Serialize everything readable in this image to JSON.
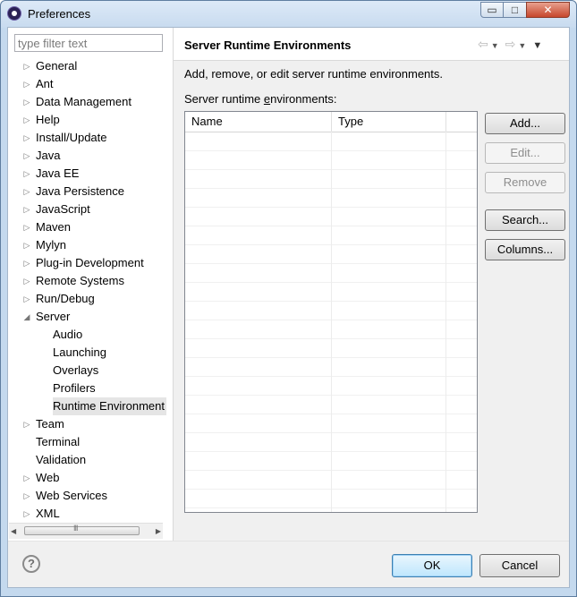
{
  "window": {
    "title": "Preferences",
    "controls": {
      "minimize": "▭",
      "maximize": "□",
      "close": "✕"
    }
  },
  "filter": {
    "placeholder": "type filter text",
    "value": ""
  },
  "tree": {
    "items": [
      {
        "label": "General",
        "level": 0,
        "expander": "collapsed"
      },
      {
        "label": "Ant",
        "level": 0,
        "expander": "collapsed"
      },
      {
        "label": "Data Management",
        "level": 0,
        "expander": "collapsed"
      },
      {
        "label": "Help",
        "level": 0,
        "expander": "collapsed"
      },
      {
        "label": "Install/Update",
        "level": 0,
        "expander": "collapsed"
      },
      {
        "label": "Java",
        "level": 0,
        "expander": "collapsed"
      },
      {
        "label": "Java EE",
        "level": 0,
        "expander": "collapsed"
      },
      {
        "label": "Java Persistence",
        "level": 0,
        "expander": "collapsed"
      },
      {
        "label": "JavaScript",
        "level": 0,
        "expander": "collapsed"
      },
      {
        "label": "Maven",
        "level": 0,
        "expander": "collapsed"
      },
      {
        "label": "Mylyn",
        "level": 0,
        "expander": "collapsed"
      },
      {
        "label": "Plug-in Development",
        "level": 0,
        "expander": "collapsed"
      },
      {
        "label": "Remote Systems",
        "level": 0,
        "expander": "collapsed"
      },
      {
        "label": "Run/Debug",
        "level": 0,
        "expander": "collapsed"
      },
      {
        "label": "Server",
        "level": 0,
        "expander": "expanded"
      },
      {
        "label": "Audio",
        "level": 1,
        "expander": "none"
      },
      {
        "label": "Launching",
        "level": 1,
        "expander": "none"
      },
      {
        "label": "Overlays",
        "level": 1,
        "expander": "none"
      },
      {
        "label": "Profilers",
        "level": 1,
        "expander": "none"
      },
      {
        "label": "Runtime Environment",
        "level": 1,
        "expander": "none",
        "selected": true
      },
      {
        "label": "Team",
        "level": 0,
        "expander": "collapsed"
      },
      {
        "label": "Terminal",
        "level": 0,
        "expander": "none"
      },
      {
        "label": "Validation",
        "level": 0,
        "expander": "none"
      },
      {
        "label": "Web",
        "level": 0,
        "expander": "collapsed"
      },
      {
        "label": "Web Services",
        "level": 0,
        "expander": "collapsed"
      },
      {
        "label": "XML",
        "level": 0,
        "expander": "collapsed"
      }
    ],
    "scroll_grip": "III"
  },
  "page": {
    "title": "Server Runtime Environments",
    "description": "Add, remove, or edit server runtime environments.",
    "table_label_pre": "Server runtime ",
    "table_label_mnemonic": "e",
    "table_label_post": "nvironments:",
    "columns": [
      "Name",
      "Type"
    ],
    "rows": []
  },
  "buttons": {
    "add": "Add...",
    "edit": "Edit...",
    "remove": "Remove",
    "search": "Search...",
    "columns": "Columns..."
  },
  "footer": {
    "help": "?",
    "ok": "OK",
    "cancel": "Cancel"
  }
}
